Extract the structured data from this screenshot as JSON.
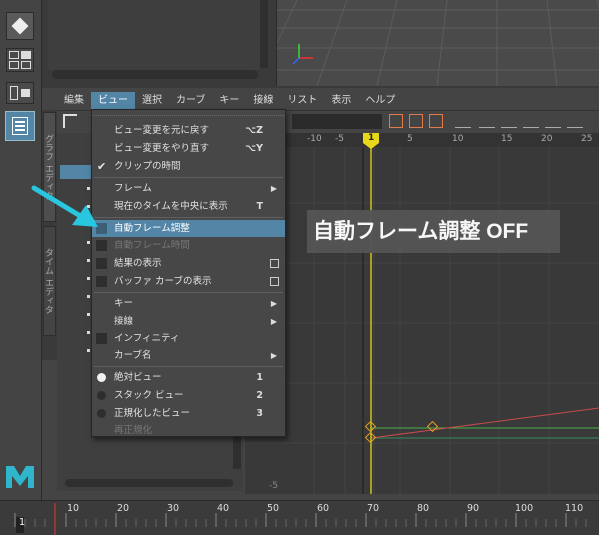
{
  "menubar": [
    "編集",
    "ビュー",
    "選択",
    "カーブ",
    "キー",
    "接線",
    "リスト",
    "表示",
    "ヘルプ"
  ],
  "menubar_active_index": 1,
  "side_tabs": [
    "グラフ エディタ",
    "タイム エディタ"
  ],
  "dropdown": {
    "items": [
      {
        "label": "ビュー変更を元に戻す",
        "shortcut": "⌥Z"
      },
      {
        "label": "ビュー変更をやり直す",
        "shortcut": "⌥Y"
      },
      {
        "label": "クリップの時間",
        "checked": true
      },
      {
        "label": "フレーム",
        "submenu": true
      },
      {
        "label": "現在のタイムを中央に表示",
        "shortcut": "T"
      },
      {
        "label": "自動フレーム調整",
        "highlighted": true
      },
      {
        "label": "自動フレーム時間",
        "disabled": true
      },
      {
        "label": "結果の表示",
        "option_box": true
      },
      {
        "label": "バッファ カーブの表示",
        "option_box": true
      },
      {
        "label": "キー",
        "submenu": true
      },
      {
        "label": "接線",
        "submenu": true
      },
      {
        "label": "インフィニティ"
      },
      {
        "label": "カーブ名",
        "submenu": true
      },
      {
        "label": "絶対ビュー",
        "shortcut": "1",
        "radio_on": true
      },
      {
        "label": "スタック ビュー",
        "shortcut": "2"
      },
      {
        "label": "正規化したビュー",
        "shortcut": "3"
      },
      {
        "label": "再正規化",
        "disabled": true
      }
    ]
  },
  "overlay_label": "自動フレーム調整 OFF",
  "graph_ruler": [
    "-10",
    "-5",
    "1",
    "5",
    "10",
    "15",
    "20",
    "25"
  ],
  "current_frame": "1",
  "graph_y_label": "-5",
  "timeline_ticks": [
    "1",
    "10",
    "20",
    "30",
    "40",
    "50",
    "60",
    "70",
    "80",
    "90",
    "100",
    "110"
  ],
  "colors": {
    "highlight": "#5285a6",
    "accent_cyan": "#29c6e0",
    "time_marker": "#e8d81a",
    "curve_red": "#c84b4b",
    "curve_green": "#4bb04b",
    "maya_logo": "#2fb6cc"
  },
  "icons": [
    "arrow-pointer-icon",
    "maya-logo-icon",
    "outliner-icon",
    "checkmark-icon"
  ]
}
